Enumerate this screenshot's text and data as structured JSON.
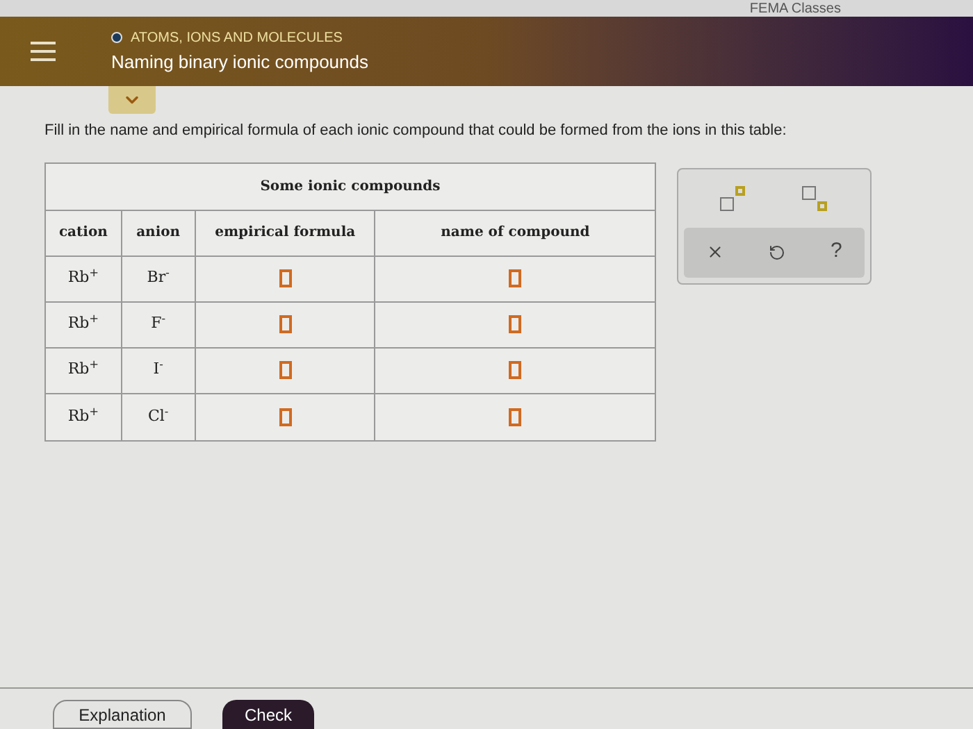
{
  "top_bar": {
    "account": "FEMA Classes"
  },
  "header": {
    "topic": "ATOMS, IONS AND MOLECULES",
    "title": "Naming binary ionic compounds"
  },
  "instruction": "Fill in the name and empirical formula of each ionic compound that could be formed from the ions in this table:",
  "table": {
    "title": "Some ionic compounds",
    "columns": [
      "cation",
      "anion",
      "empirical formula",
      "name of compound"
    ],
    "rows": [
      {
        "cation": "Rb$^{+}$",
        "anion": "Br$^{-}$"
      },
      {
        "cation": "Rb$^{+}$",
        "anion": "F$^{-}$"
      },
      {
        "cation": "Rb$^{+}$",
        "anion": "I$^{-}$"
      },
      {
        "cation": "Rb$^{+}$",
        "anion": "Cl$^{-}$"
      }
    ]
  },
  "tools": {
    "help_label": "?"
  },
  "footer": {
    "buttons": [
      {
        "label": "Explanation",
        "kind": "outline"
      },
      {
        "label": "Check",
        "kind": "primary"
      }
    ]
  }
}
